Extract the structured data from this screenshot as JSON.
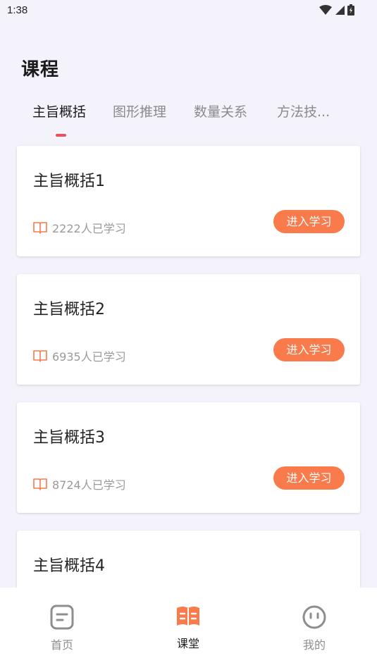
{
  "status_bar": {
    "time": "1:38",
    "icons": [
      "wifi-icon",
      "signal-icon",
      "battery-icon"
    ]
  },
  "header": {
    "title": "课程"
  },
  "tabs": [
    {
      "label": "主旨概括",
      "active": true
    },
    {
      "label": "图形推理",
      "active": false
    },
    {
      "label": "数量关系",
      "active": false
    },
    {
      "label": "方法技..."
    }
  ],
  "cards": [
    {
      "title": "主旨概括1",
      "learners": "2222人已学习",
      "button": "进入学习"
    },
    {
      "title": "主旨概括2",
      "learners": "6935人已学习",
      "button": "进入学习"
    },
    {
      "title": "主旨概括3",
      "learners": "8724人已学习",
      "button": "进入学习"
    },
    {
      "title": "主旨概括4"
    }
  ],
  "bottom_nav": {
    "items": [
      {
        "label": "首页",
        "icon": "home-icon",
        "active": false
      },
      {
        "label": "课堂",
        "icon": "classroom-book-icon",
        "active": true
      },
      {
        "label": "我的",
        "icon": "profile-icon",
        "active": false
      }
    ]
  },
  "colors": {
    "background": "#f4f2fb",
    "accent": "#f97a4b",
    "tab_indicator": "#ef4f5a",
    "active_nav_icon": "#f97a4b"
  }
}
